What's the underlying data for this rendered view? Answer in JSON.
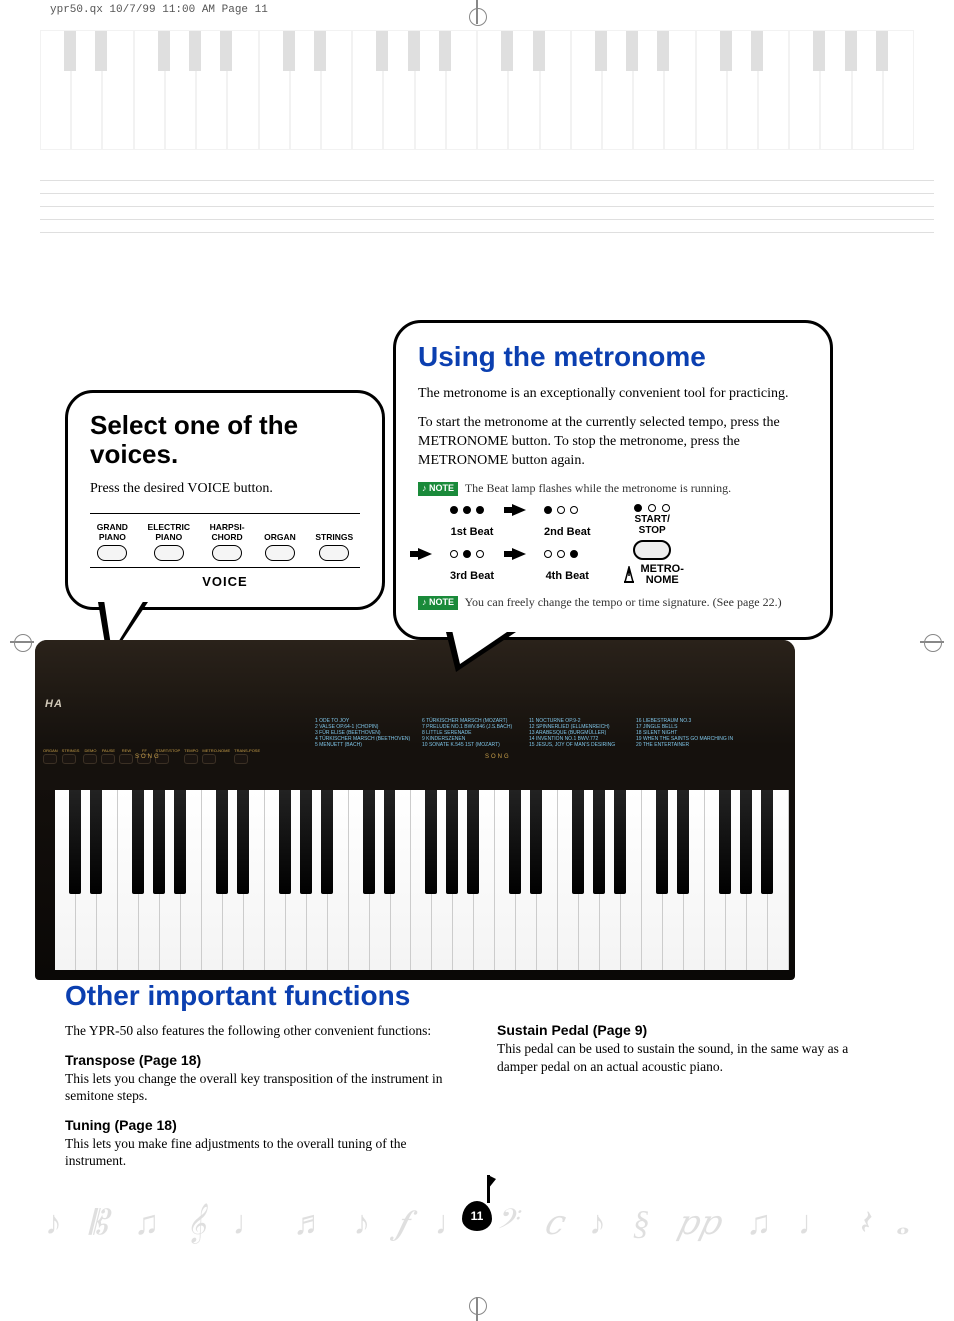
{
  "print_header": "ypr50.qx  10/7/99  11:00 AM  Page 11",
  "voice_bubble": {
    "title": "Select one of the voices.",
    "instruction": "Press the desired VOICE button.",
    "buttons": [
      {
        "line1": "GRAND",
        "line2": "PIANO"
      },
      {
        "line1": "ELECTRIC",
        "line2": "PIANO"
      },
      {
        "line1": "HARPSI-",
        "line2": "CHORD"
      },
      {
        "line1": "ORGAN",
        "line2": ""
      },
      {
        "line1": "STRINGS",
        "line2": ""
      }
    ],
    "section_label": "VOICE"
  },
  "metronome_bubble": {
    "title": "Using the metronome",
    "para1": "The metronome is an exceptionally convenient tool for practicing.",
    "para2": "To start the metronome at the currently selected tempo, press the METRONOME button.  To stop the metronome, press the METRONOME button again.",
    "note1_tag": "NOTE",
    "note1_text": "The Beat lamp flashes while the metronome is running.",
    "beats": {
      "b1": "1st Beat",
      "b2": "2nd Beat",
      "b3": "3rd Beat",
      "b4": "4th Beat"
    },
    "start_stop": "START/\nSTOP",
    "metro_label1": "METRO-",
    "metro_label2": "NOME",
    "note2_tag": "NOTE",
    "note2_text": "You can freely change the tempo or time signature.  (See page 22.)"
  },
  "keyboard": {
    "brand": "HA",
    "song_label": "SONG",
    "panel_labels": [
      "ORGAN",
      "STRINGS",
      "DEMO",
      "PAUSE",
      "REW",
      "FF",
      "START/STOP",
      "TEMPO",
      "METRO-NOME",
      "TRANS-POSE"
    ],
    "songlist": [
      "1 ODE TO JOY",
      "2 VALSE OP.64-1 (CHOPIN)",
      "3 FÜR ELISE (BEETHOVEN)",
      "4 TÜRKISCHER MARSCH (BEETHOVEN)",
      "5 MENUETT (BACH)",
      "6 TÜRKISCHER MARSCH (MOZART)",
      "7 PRELUDE NO.1 BWV.846 (J.S.BACH)",
      "8 LITTLE SERENADE",
      "9 KINDERSZENEN",
      "10 SONATE K.545 1ST (MOZART)",
      "11 NOCTURNE OP.9-2",
      "12 SPINNERLIED (ELLMENREICH)",
      "13 ARABESQUE (BURGMÜLLER)",
      "14 INVENTION NO.1 BWV.772",
      "15 JESUS, JOY OF MAN'S DESIRING",
      "16 LIEBESTRAUM NO.3",
      "17 JINGLE BELLS",
      "18 SILENT NIGHT",
      "19 WHEN THE SAINTS GO MARCHING IN",
      "20 THE ENTERTAINER"
    ]
  },
  "other": {
    "title": "Other important functions",
    "intro": "The YPR-50 also features the following other convenient functions:",
    "transpose_h": "Transpose (Page 18)",
    "transpose_p": "This lets you change the overall key transposition of the instrument in semitone steps.",
    "tuning_h": "Tuning (Page 18)",
    "tuning_p": "This lets you make fine adjustments to the overall tuning of the instrument.",
    "sustain_h": "Sustain Pedal (Page 9)",
    "sustain_p": "This pedal can be used to sustain the sound, in the same way as a damper pedal on an actual acoustic piano."
  },
  "page_number": "11",
  "music_symbols": [
    "♪",
    "𝄡",
    "♫",
    "𝄞",
    "♩",
    "♬",
    "♪",
    "𝆑",
    "♩",
    "𝄢",
    "𝑐",
    "♪",
    "§",
    "𝑝𝑝",
    "♫",
    "♩",
    "𝄽",
    "𝅝"
  ]
}
